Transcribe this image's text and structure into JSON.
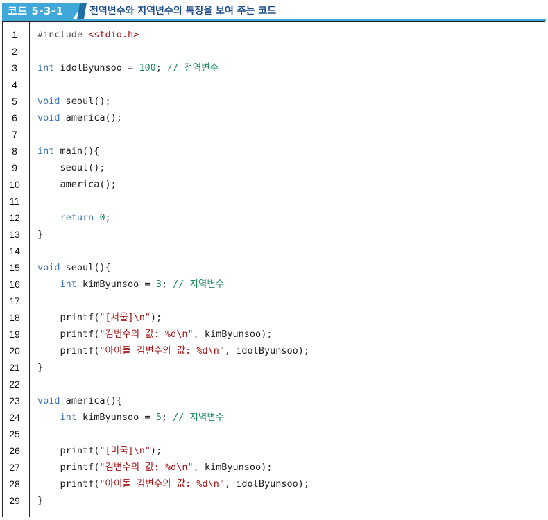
{
  "header": {
    "tag_label": "코드 5-3-1",
    "title": "전역변수와 지역변수의 특징을 보여 주는 코드"
  },
  "colors": {
    "tag_background": "#3fa8d8",
    "title_text": "#1f4e8c",
    "keyword": "#3a75b0",
    "string": "#a31515",
    "number_and_comment": "#1a8a5a"
  },
  "code_lines": [
    {
      "n": "1",
      "tokens": [
        {
          "t": "pp",
          "v": "#include "
        },
        {
          "t": "inc",
          "v": "<stdio.h>"
        }
      ]
    },
    {
      "n": "2",
      "tokens": []
    },
    {
      "n": "3",
      "tokens": [
        {
          "t": "kw",
          "v": "int"
        },
        {
          "t": "",
          "v": " idolByunsoo = "
        },
        {
          "t": "num",
          "v": "100"
        },
        {
          "t": "",
          "v": "; "
        },
        {
          "t": "cm",
          "v": "// 전역변수"
        }
      ]
    },
    {
      "n": "4",
      "tokens": []
    },
    {
      "n": "5",
      "tokens": [
        {
          "t": "kw",
          "v": "void"
        },
        {
          "t": "",
          "v": " seoul();"
        }
      ]
    },
    {
      "n": "6",
      "tokens": [
        {
          "t": "kw",
          "v": "void"
        },
        {
          "t": "",
          "v": " america();"
        }
      ]
    },
    {
      "n": "7",
      "tokens": []
    },
    {
      "n": "8",
      "tokens": [
        {
          "t": "kw",
          "v": "int"
        },
        {
          "t": "",
          "v": " main(){"
        }
      ]
    },
    {
      "n": "9",
      "tokens": [
        {
          "t": "",
          "v": "    seoul();"
        }
      ]
    },
    {
      "n": "10",
      "tokens": [
        {
          "t": "",
          "v": "    america();"
        }
      ]
    },
    {
      "n": "11",
      "tokens": []
    },
    {
      "n": "12",
      "tokens": [
        {
          "t": "",
          "v": "    "
        },
        {
          "t": "kw",
          "v": "return"
        },
        {
          "t": "",
          "v": " "
        },
        {
          "t": "num",
          "v": "0"
        },
        {
          "t": "",
          "v": ";"
        }
      ]
    },
    {
      "n": "13",
      "tokens": [
        {
          "t": "",
          "v": "}"
        }
      ]
    },
    {
      "n": "14",
      "tokens": []
    },
    {
      "n": "15",
      "tokens": [
        {
          "t": "kw",
          "v": "void"
        },
        {
          "t": "",
          "v": " seoul(){"
        }
      ]
    },
    {
      "n": "16",
      "tokens": [
        {
          "t": "",
          "v": "    "
        },
        {
          "t": "kw",
          "v": "int"
        },
        {
          "t": "",
          "v": " kimByunsoo = "
        },
        {
          "t": "num",
          "v": "3"
        },
        {
          "t": "",
          "v": "; "
        },
        {
          "t": "cm",
          "v": "// 지역변수"
        }
      ]
    },
    {
      "n": "17",
      "tokens": []
    },
    {
      "n": "18",
      "tokens": [
        {
          "t": "",
          "v": "    printf("
        },
        {
          "t": "str",
          "v": "\"[서울]\\n\""
        },
        {
          "t": "",
          "v": ");"
        }
      ]
    },
    {
      "n": "19",
      "tokens": [
        {
          "t": "",
          "v": "    printf("
        },
        {
          "t": "str",
          "v": "\"김변수의 값: %d\\n\""
        },
        {
          "t": "",
          "v": ", kimByunsoo);"
        }
      ]
    },
    {
      "n": "20",
      "tokens": [
        {
          "t": "",
          "v": "    printf("
        },
        {
          "t": "str",
          "v": "\"아이돌 김변수의 값: %d\\n\""
        },
        {
          "t": "",
          "v": ", idolByunsoo);"
        }
      ]
    },
    {
      "n": "21",
      "tokens": [
        {
          "t": "",
          "v": "}"
        }
      ]
    },
    {
      "n": "22",
      "tokens": []
    },
    {
      "n": "23",
      "tokens": [
        {
          "t": "kw",
          "v": "void"
        },
        {
          "t": "",
          "v": " america(){"
        }
      ]
    },
    {
      "n": "24",
      "tokens": [
        {
          "t": "",
          "v": "    "
        },
        {
          "t": "kw",
          "v": "int"
        },
        {
          "t": "",
          "v": " kimByunsoo = "
        },
        {
          "t": "num",
          "v": "5"
        },
        {
          "t": "",
          "v": "; "
        },
        {
          "t": "cm",
          "v": "// 지역변수"
        }
      ]
    },
    {
      "n": "25",
      "tokens": []
    },
    {
      "n": "26",
      "tokens": [
        {
          "t": "",
          "v": "    printf("
        },
        {
          "t": "str",
          "v": "\"[미국]\\n\""
        },
        {
          "t": "",
          "v": ");"
        }
      ]
    },
    {
      "n": "27",
      "tokens": [
        {
          "t": "",
          "v": "    printf("
        },
        {
          "t": "str",
          "v": "\"김변수의 값: %d\\n\""
        },
        {
          "t": "",
          "v": ", kimByunsoo);"
        }
      ]
    },
    {
      "n": "28",
      "tokens": [
        {
          "t": "",
          "v": "    printf("
        },
        {
          "t": "str",
          "v": "\"아이돌 김변수의 값: %d\\n\""
        },
        {
          "t": "",
          "v": ", idolByunsoo);"
        }
      ]
    },
    {
      "n": "29",
      "tokens": [
        {
          "t": "",
          "v": "}"
        }
      ]
    }
  ]
}
